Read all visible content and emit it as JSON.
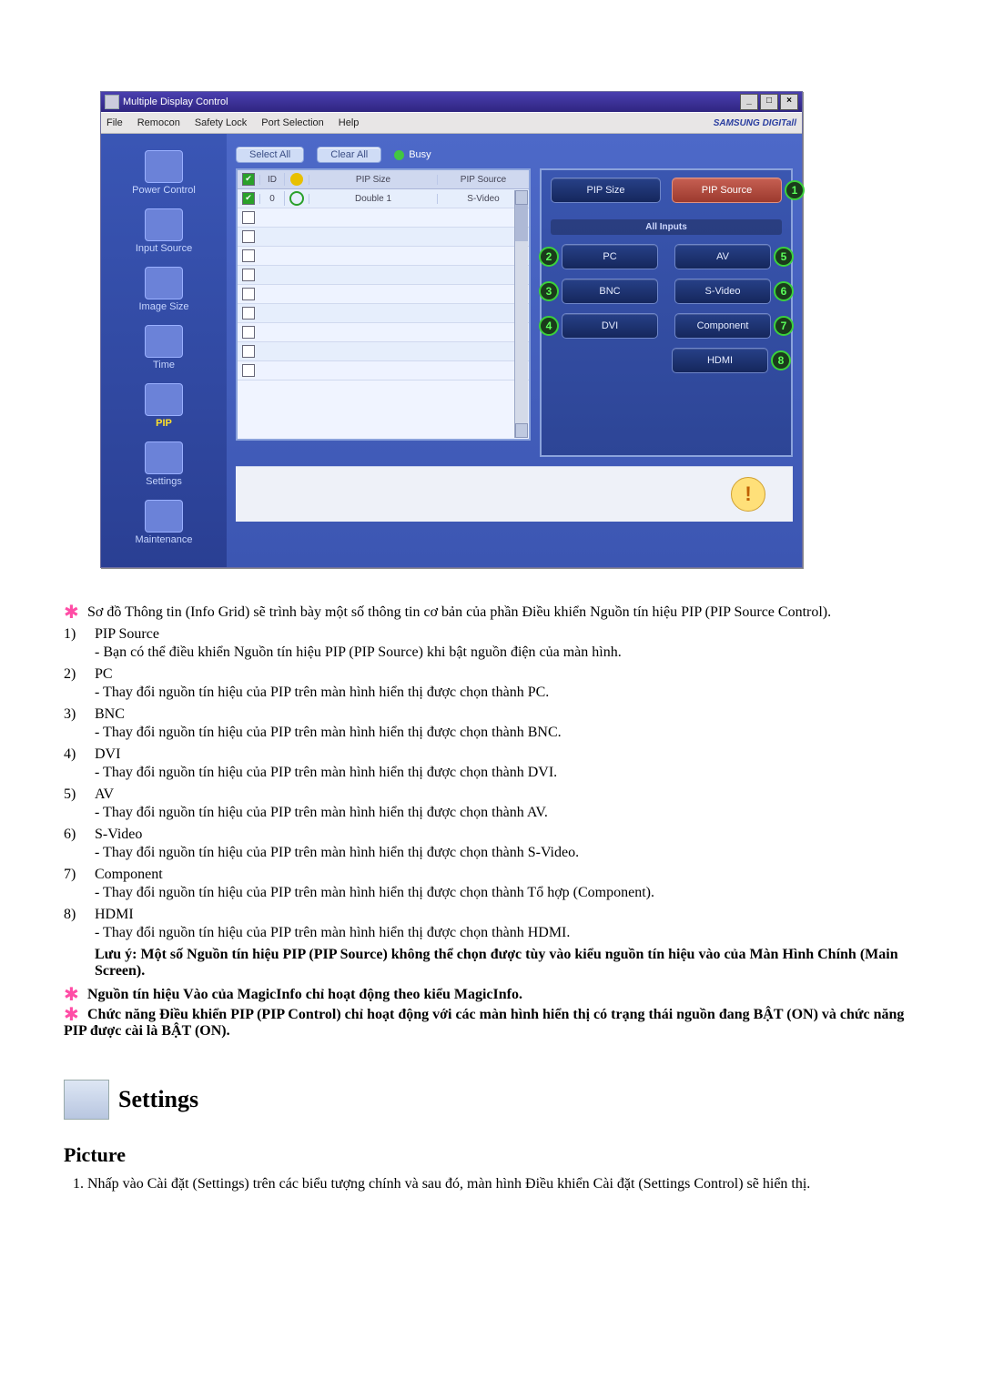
{
  "window": {
    "title": "Multiple Display Control",
    "min": "_",
    "max": "□",
    "close": "×"
  },
  "menu": {
    "file": "File",
    "remocon": "Remocon",
    "safety": "Safety Lock",
    "port": "Port Selection",
    "help": "Help",
    "brand": "SAMSUNG DIGITall"
  },
  "sidebar": {
    "power": "Power Control",
    "input": "Input Source",
    "imgsize": "Image Size",
    "time": "Time",
    "pip": "PIP",
    "settings": "Settings",
    "maint": "Maintenance"
  },
  "topbtns": {
    "select": "Select All",
    "clear": "Clear All",
    "busy": "Busy"
  },
  "grid": {
    "h_id": "ID",
    "h_size": "PIP Size",
    "h_src": "PIP Source",
    "row0": {
      "id": "0",
      "size": "Double 1",
      "src": "S-Video"
    }
  },
  "cp": {
    "size": "PIP Size",
    "src": "PIP Source",
    "all": "All Inputs",
    "pc": "PC",
    "bnc": "BNC",
    "dvi": "DVI",
    "av": "AV",
    "svideo": "S-Video",
    "comp": "Component",
    "hdmi": "HDMI",
    "n1": "1",
    "n2": "2",
    "n3": "3",
    "n4": "4",
    "n5": "5",
    "n6": "6",
    "n7": "7",
    "n8": "8"
  },
  "doc": {
    "intro": "Sơ đồ Thông tin (Info Grid) sẽ trình bày một số thông tin cơ bản của phần Điều khiển Nguồn tín hiệu PIP (PIP Source Control).",
    "items": [
      {
        "n": "1)",
        "t": "PIP Source",
        "d": "- Bạn có thể điều khiển Nguồn tín hiệu PIP (PIP Source) khi bật nguồn điện của màn hình."
      },
      {
        "n": "2)",
        "t": "PC",
        "d": "- Thay đổi nguồn tín hiệu của PIP trên màn hình hiển thị được chọn thành PC."
      },
      {
        "n": "3)",
        "t": "BNC",
        "d": "- Thay đổi nguồn tín hiệu của PIP trên màn hình hiển thị được chọn thành BNC."
      },
      {
        "n": "4)",
        "t": "DVI",
        "d": "- Thay đổi nguồn tín hiệu của PIP trên màn hình hiển thị được chọn thành DVI."
      },
      {
        "n": "5)",
        "t": "AV",
        "d": "- Thay đổi nguồn tín hiệu của PIP trên màn hình hiển thị được chọn thành AV."
      },
      {
        "n": "6)",
        "t": "S-Video",
        "d": "- Thay đổi nguồn tín hiệu của PIP trên màn hình hiển thị được chọn thành S-Video."
      },
      {
        "n": "7)",
        "t": "Component",
        "d": "- Thay đổi nguồn tín hiệu của PIP trên màn hình hiển thị được chọn thành Tổ hợp (Component)."
      },
      {
        "n": "8)",
        "t": "HDMI",
        "d": "- Thay đổi nguồn tín hiệu của PIP trên màn hình hiển thị được chọn thành HDMI."
      }
    ],
    "note8b": "Lưu ý: Một số Nguồn tín hiệu PIP (PIP Source) không thể chọn được tùy vào kiểu nguồn tín hiệu vào của Màn Hình Chính (Main Screen).",
    "star2": "Nguồn tín hiệu Vào của MagicInfo chỉ hoạt động theo kiểu MagicInfo.",
    "star3": "Chức năng Điều khiển PIP (PIP Control) chỉ hoạt động với các màn hình hiển thị có trạng thái nguồn đang BẬT (ON) và chức năng PIP được cài là BẬT (ON).",
    "settings_h": "Settings",
    "picture_h": "Picture",
    "picture_1": "Nhấp vào Cài đặt (Settings) trên các biểu tượng chính và sau đó, màn hình Điều khiển Cài đặt (Settings Control) sẽ hiển thị."
  }
}
